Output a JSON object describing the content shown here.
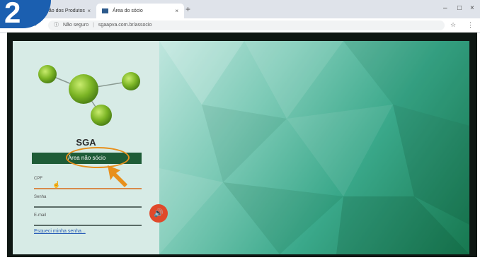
{
  "step": {
    "number": "2"
  },
  "browser": {
    "tabs": [
      {
        "label": "...ição dos Produtos"
      },
      {
        "label": "Área do sócio"
      }
    ],
    "new_tab": "+",
    "address": {
      "security": "Não seguro",
      "url": "sgaapva.com.br/associo"
    },
    "window_controls": {
      "minimize": "–",
      "maximize": "□",
      "close": "×"
    }
  },
  "login": {
    "app_name": "SGA",
    "area_button": "Área não sócio",
    "fields": {
      "cpf": {
        "label": "CPF"
      },
      "senha": {
        "label": "Senha"
      },
      "email": {
        "label": "E-mail"
      }
    },
    "forgot_link": "Esqueci minha senha...",
    "audio_icon": "speaker-icon"
  },
  "colors": {
    "brand_green": "#1e5c37",
    "highlight": "#e8901c",
    "audio_button": "#e0492a",
    "badge": "#1b5fb0"
  }
}
